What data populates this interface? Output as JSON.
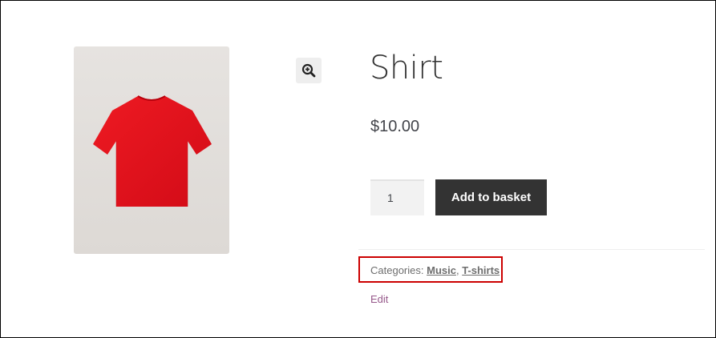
{
  "product": {
    "title": "Shirt",
    "price": "$10.00",
    "quantity": "1",
    "add_to_basket_label": "Add to basket",
    "categories_label": "Categories:",
    "categories": [
      "Music",
      "T-shirts"
    ],
    "separator": ",",
    "edit_label": "Edit"
  },
  "icons": {
    "zoom": "zoom-in-magnifier-icon"
  },
  "colors": {
    "button_bg": "#333333",
    "highlight_border": "#cc0000",
    "edit_link": "#96588a",
    "shirt": "#e0101c"
  }
}
